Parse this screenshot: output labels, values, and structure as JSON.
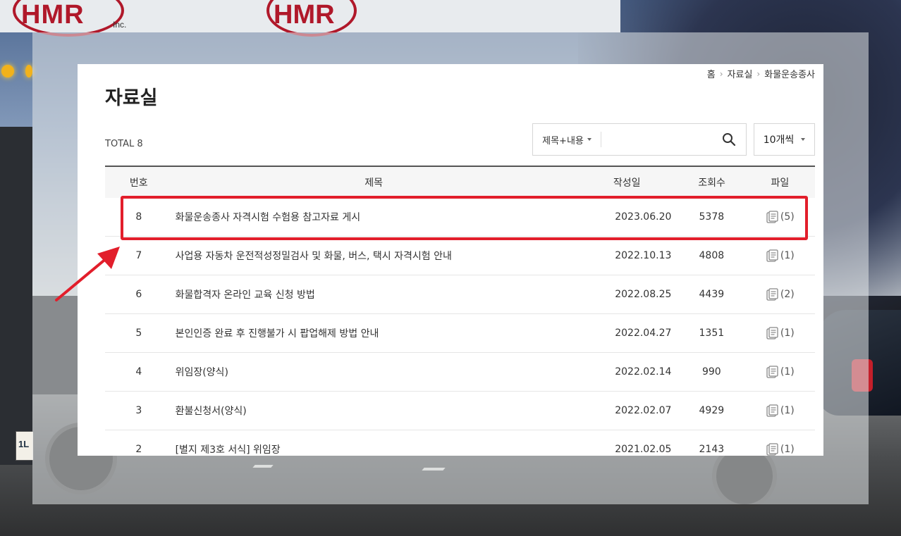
{
  "background": {
    "logo_text": "HMR",
    "logo_inc": "Inc.",
    "logo_text2": "HMR",
    "plate_text": "1L"
  },
  "breadcrumb": [
    "홈",
    "자료실",
    "화물운송종사"
  ],
  "page_title": "자료실",
  "total_label": "TOTAL 8",
  "search": {
    "type_label": "제목+내용",
    "placeholder": "",
    "per_page_label": "10개씩"
  },
  "table": {
    "headers": {
      "num": "번호",
      "title": "제목",
      "date": "작성일",
      "views": "조회수",
      "file": "파일"
    },
    "rows": [
      {
        "num": "8",
        "title": "화물운송종사 자격시험 수험용 참고자료 게시",
        "date": "2023.06.20",
        "views": "5378",
        "file": "(5)"
      },
      {
        "num": "7",
        "title": "사업용 자동차 운전적성정밀검사 및 화물, 버스, 택시 자격시험 안내",
        "date": "2022.10.13",
        "views": "4808",
        "file": "(1)"
      },
      {
        "num": "6",
        "title": "화물합격자 온라인 교육 신청 방법",
        "date": "2022.08.25",
        "views": "4439",
        "file": "(2)"
      },
      {
        "num": "5",
        "title": "본인인증 완료 후 진행불가 시 팝업해제 방법 안내",
        "date": "2022.04.27",
        "views": "1351",
        "file": "(1)"
      },
      {
        "num": "4",
        "title": "위임장(양식)",
        "date": "2022.02.14",
        "views": "990",
        "file": "(1)"
      },
      {
        "num": "3",
        "title": "환불신청서(양식)",
        "date": "2022.02.07",
        "views": "4929",
        "file": "(1)"
      },
      {
        "num": "2",
        "title": "[별지 제3호 서식] 위임장",
        "date": "2021.02.05",
        "views": "2143",
        "file": "(1)"
      }
    ]
  },
  "colors": {
    "highlight": "#e21e2b",
    "accent_text": "#222222"
  }
}
